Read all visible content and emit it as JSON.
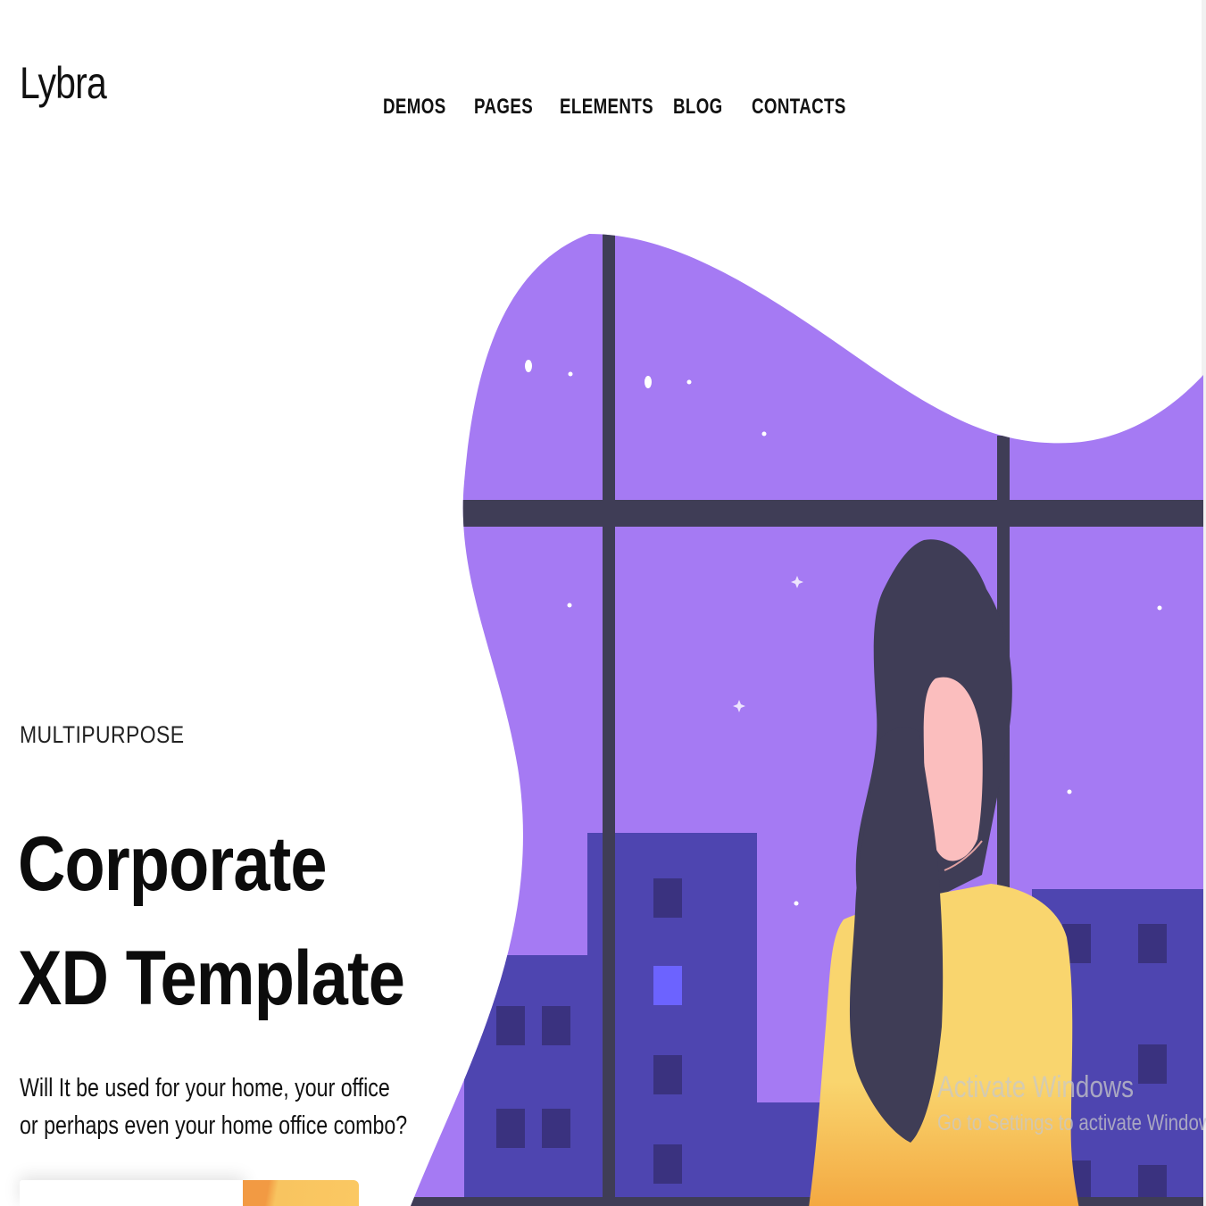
{
  "header": {
    "logo": "Lybra",
    "nav": [
      {
        "label": "DEMOS"
      },
      {
        "label": "PAGES"
      },
      {
        "label": "ELEMENTS"
      },
      {
        "label": "BLOG"
      },
      {
        "label": "CONTACTS"
      }
    ]
  },
  "hero": {
    "eyebrow": "MULTIPURPOSE",
    "headline_line1": "Corporate",
    "headline_line2": "XD Template",
    "subtext_line1": "Will It be used for your home, your office",
    "subtext_line2": "or perhaps even your home office combo?"
  },
  "watermark": {
    "title": "Activate Windows",
    "subtitle": "Go to Settings to activate Windows."
  },
  "colors": {
    "sky_top": "#6c63ff",
    "sky_bottom": "#a57af3",
    "frame": "#3f3d56",
    "building": "#4e45b0",
    "window_dark": "#3a327f",
    "window_lit": "#6c63ff",
    "sweater": "#f9d56e",
    "sweater_shade": "#f3a63f",
    "skin": "#fbbebe",
    "hair": "#3f3d56",
    "cta_orange": "#f29a43",
    "cta_yellow": "#fbc862"
  }
}
